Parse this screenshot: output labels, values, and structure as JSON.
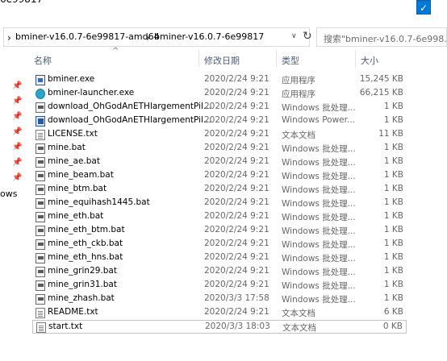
{
  "window": {
    "title_fragment": "6e99817",
    "checkbox_mark": "✓"
  },
  "address_bar": {
    "separator": "›",
    "crumbs": [
      "bminer-v16.0.7-6e99817-amd64",
      "bminer-v16.0.7-6e99817"
    ],
    "dropdown_glyph": "∨",
    "refresh_glyph": "↻"
  },
  "search": {
    "placeholder": "搜索\"bminer-v16.0.7-6e998..."
  },
  "columns": {
    "name": "名称",
    "date": "修改日期",
    "type": "类型",
    "size": "大小",
    "sort_glyph": "^"
  },
  "nav": {
    "pin_glyph": "📌",
    "fragment": "ows"
  },
  "files": [
    {
      "name": "bminer.exe",
      "date": "2020/2/24 9:21",
      "type": "应用程序",
      "size": "15,245 KB",
      "icon": "exe-icon"
    },
    {
      "name": "bminer-launcher.exe",
      "date": "2020/2/24 9:21",
      "type": "应用程序",
      "size": "66,215 KB",
      "icon": "launcher-icon"
    },
    {
      "name": "download_OhGodAnETHlargementPil...",
      "date": "2020/2/24 9:21",
      "type": "Windows 批处理...",
      "size": "1 KB",
      "icon": "bat-icon"
    },
    {
      "name": "download_OhGodAnETHlargementPil...",
      "date": "2020/2/24 9:21",
      "type": "Windows Power...",
      "size": "1 KB",
      "icon": "ps1-icon"
    },
    {
      "name": "LICENSE.txt",
      "date": "2020/2/24 9:21",
      "type": "文本文档",
      "size": "11 KB",
      "icon": "txt-icon"
    },
    {
      "name": "mine.bat",
      "date": "2020/2/24 9:21",
      "type": "Windows 批处理...",
      "size": "1 KB",
      "icon": "bat-icon"
    },
    {
      "name": "mine_ae.bat",
      "date": "2020/2/24 9:21",
      "type": "Windows 批处理...",
      "size": "1 KB",
      "icon": "bat-icon"
    },
    {
      "name": "mine_beam.bat",
      "date": "2020/2/24 9:21",
      "type": "Windows 批处理...",
      "size": "1 KB",
      "icon": "bat-icon"
    },
    {
      "name": "mine_btm.bat",
      "date": "2020/2/24 9:21",
      "type": "Windows 批处理...",
      "size": "1 KB",
      "icon": "bat-icon"
    },
    {
      "name": "mine_equihash1445.bat",
      "date": "2020/2/24 9:21",
      "type": "Windows 批处理...",
      "size": "1 KB",
      "icon": "bat-icon"
    },
    {
      "name": "mine_eth.bat",
      "date": "2020/2/24 9:21",
      "type": "Windows 批处理...",
      "size": "1 KB",
      "icon": "bat-icon"
    },
    {
      "name": "mine_eth_btm.bat",
      "date": "2020/2/24 9:21",
      "type": "Windows 批处理...",
      "size": "1 KB",
      "icon": "bat-icon"
    },
    {
      "name": "mine_eth_ckb.bat",
      "date": "2020/2/24 9:21",
      "type": "Windows 批处理...",
      "size": "1 KB",
      "icon": "bat-icon"
    },
    {
      "name": "mine_eth_hns.bat",
      "date": "2020/2/24 9:21",
      "type": "Windows 批处理...",
      "size": "1 KB",
      "icon": "bat-icon"
    },
    {
      "name": "mine_grin29.bat",
      "date": "2020/2/24 9:21",
      "type": "Windows 批处理...",
      "size": "1 KB",
      "icon": "bat-icon"
    },
    {
      "name": "mine_grin31.bat",
      "date": "2020/2/24 9:21",
      "type": "Windows 批处理...",
      "size": "1 KB",
      "icon": "bat-icon"
    },
    {
      "name": "mine_zhash.bat",
      "date": "2020/3/3 17:58",
      "type": "Windows 批处理...",
      "size": "1 KB",
      "icon": "bat-icon"
    },
    {
      "name": "README.txt",
      "date": "2020/2/24 9:21",
      "type": "文本文档",
      "size": "6 KB",
      "icon": "txt-icon"
    },
    {
      "name": "start.txt",
      "date": "2020/3/3 18:03",
      "type": "文本文档",
      "size": "0 KB",
      "icon": "txt-icon"
    }
  ]
}
